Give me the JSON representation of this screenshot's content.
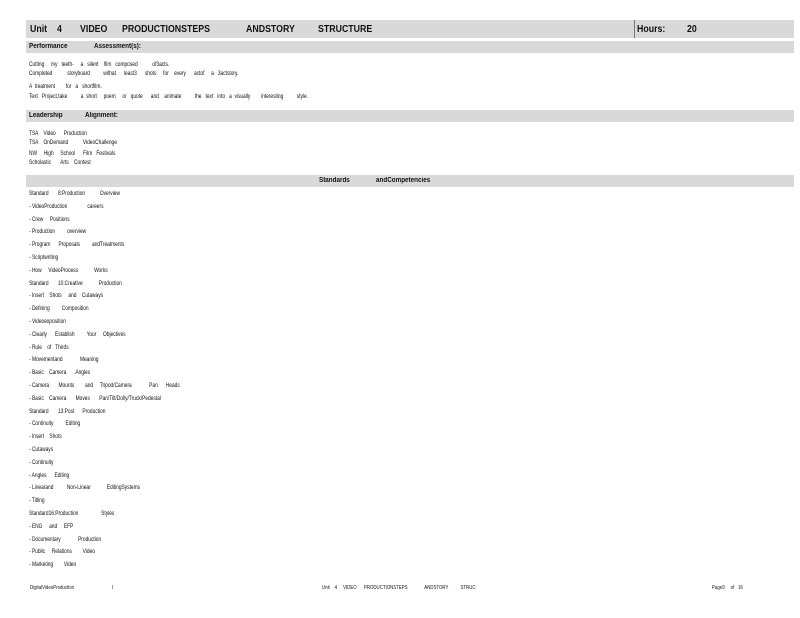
{
  "header": {
    "unit_label": "Unit",
    "unit_number": "4",
    "w1": "VIDEO",
    "w2": "PRODUCTIONSTEPS",
    "w3": "ANDSTORY",
    "w4": "STRUCTURE",
    "hours_label": "Hours:",
    "hours_value": "20"
  },
  "performance": {
    "label": "Performance",
    "label2": "Assessment(s):",
    "lines": [
      "Cutting     my   teeth-     a   silent    film   composed           of3acts.",
      "Completed           storyboard          withat      least3      shots     for    every      actof     a   3actstory.",
      "A  treatment        for   a   shortfilm.",
      "Text   Project,take          a  short     poem     or   quote      and    animate          the   text   into   a  visually        interesting          style."
    ]
  },
  "leadership": {
    "label": "Leadership",
    "label2": "Alignment:",
    "lines": [
      "TSA    Video      Production",
      "TSA    OnDemand           VideoChallenge",
      "NW     High     School      Film   Festivals",
      "Scholastic       Arts    Contest"
    ]
  },
  "standards": {
    "label": "Standards",
    "label2": "andCompetencies",
    "lines": [
      "Standard       8:Production           Overview",
      "- VideoProduction               careers",
      "- Crew     Positions",
      "- Production         overview",
      "- Program      Proposals         andTreatments",
      "- Scriptwriting",
      "- How     VideoProcess            Works",
      "Standard       10:Creative            Production",
      "- Insert    Shots     and    Cutaways",
      "- Defining         Composition",
      "- Videoexposition",
      "- Clearly      Establish         Your     Objectives",
      "- Rule    of   Thirds",
      "- Movementand             Meaning",
      "- Basic    Camera       Angles",
      "- Camera       Mounts        and     Tripod/Camera             Pan      Heads",
      "- Basic    Camera       Moves       Pan/Tilt/Dolly/Truck/Pedestal",
      "Standard       13:Post      Production",
      "- Continuity         Editing",
      "- Insert    Shots",
      "- Cutaways",
      "- Continuity",
      "- Angles      Editing",
      "- Linearand          Non-Linear            EditingSystems",
      "- Titling",
      "Standard16:Production                 Styles",
      "- ENG     and     EFP",
      "- Documentary             Production",
      "- Public     Relations        Video",
      "- Marketing        Video"
    ]
  },
  "footer": {
    "left": "DigitalVideoProduction",
    "bar": "I",
    "middle": "Unit    4     VIDEO      PRODUCTIONSTEPS              ANDSTORY          STRUC",
    "page": "Page9     of   16"
  }
}
